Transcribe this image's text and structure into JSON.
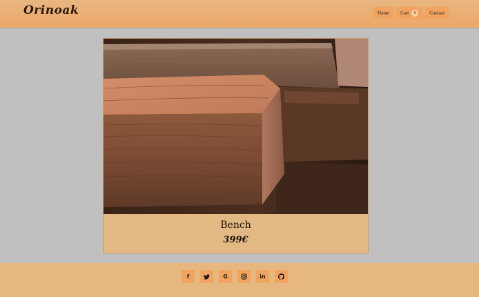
{
  "header": {
    "brand": "Orinoak",
    "nav": [
      {
        "label": "Home"
      },
      {
        "label": "Cart",
        "count": "0"
      },
      {
        "label": "Contact"
      }
    ]
  },
  "product": {
    "title": "Bench",
    "price": "399€",
    "image_icon": "wood-beams-photo"
  },
  "footer": {
    "social": [
      {
        "icon": "facebook-icon",
        "glyph": "f"
      },
      {
        "icon": "twitter-icon",
        "glyph": "🐦"
      },
      {
        "icon": "google-icon",
        "glyph": "G"
      },
      {
        "icon": "instagram-icon",
        "glyph": "◎"
      },
      {
        "icon": "linkedin-icon",
        "glyph": "in"
      },
      {
        "icon": "github-icon",
        "glyph": "◉"
      }
    ]
  },
  "colors": {
    "header": "#eda767",
    "button": "#f0a460",
    "card": "#e2b983",
    "page_bg": "#c0c0c0"
  }
}
